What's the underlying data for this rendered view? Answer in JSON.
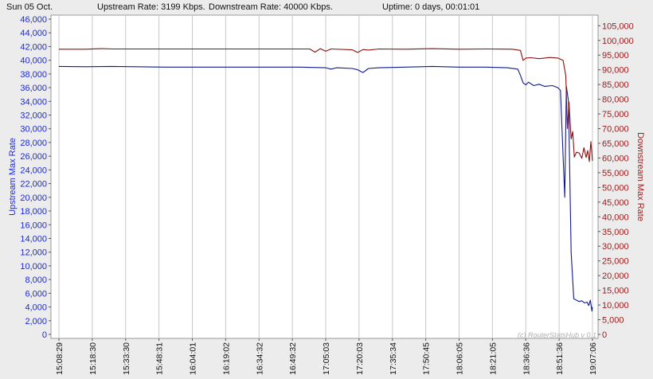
{
  "header": {
    "date": "Sun 05 Oct.",
    "upstream": "Upstream Rate: 3199 Kbps.",
    "downstream": "Downstream Rate: 40000 Kbps.",
    "uptime": "Uptime: 0 days, 00:01:01"
  },
  "chart_data": {
    "type": "line",
    "ylabel": "Upstream Max Rate",
    "y2label": "Downstream Max Rate",
    "watermark": "(c) RouterStatsHub v 0.1",
    "ylim": [
      0,
      46000
    ],
    "y2lim": [
      0,
      107500
    ],
    "yticks": [
      "0",
      "2,000",
      "4,000",
      "6,000",
      "8,000",
      "10,000",
      "12,000",
      "14,000",
      "16,000",
      "18,000",
      "20,000",
      "22,000",
      "24,000",
      "26,000",
      "28,000",
      "30,000",
      "32,000",
      "34,000",
      "36,000",
      "38,000",
      "40,000",
      "42,000",
      "44,000",
      "46,000"
    ],
    "y2ticks": [
      "0",
      "5,000",
      "10,000",
      "15,000",
      "20,000",
      "25,000",
      "30,000",
      "35,000",
      "40,000",
      "45,000",
      "50,000",
      "55,000",
      "60,000",
      "65,000",
      "70,000",
      "75,000",
      "80,000",
      "85,000",
      "90,000",
      "95,000",
      "100,000",
      "105,000"
    ],
    "xticks": [
      "15:08:29",
      "15:18:30",
      "15:33:30",
      "15:48:31",
      "16:04:01",
      "16:19:02",
      "16:34:32",
      "16:49:32",
      "17:05:03",
      "17:20:03",
      "17:35:34",
      "17:50:45",
      "18:06:05",
      "18:21:05",
      "18:36:36",
      "18:51:36",
      "19:07:06"
    ],
    "series": [
      {
        "axis": "left",
        "color": "#0f1a8c",
        "points": [
          [
            0,
            39100
          ],
          [
            0.05,
            39050
          ],
          [
            0.1,
            39100
          ],
          [
            0.2,
            39000
          ],
          [
            0.3,
            39000
          ],
          [
            0.4,
            39000
          ],
          [
            0.45,
            39000
          ],
          [
            0.5,
            38900
          ],
          [
            0.51,
            38700
          ],
          [
            0.52,
            38900
          ],
          [
            0.55,
            38800
          ],
          [
            0.56,
            38600
          ],
          [
            0.57,
            38200
          ],
          [
            0.58,
            38800
          ],
          [
            0.6,
            38900
          ],
          [
            0.65,
            39000
          ],
          [
            0.7,
            39100
          ],
          [
            0.75,
            39000
          ],
          [
            0.8,
            39000
          ],
          [
            0.84,
            38900
          ],
          [
            0.86,
            38700
          ],
          [
            0.865,
            37800
          ],
          [
            0.87,
            36700
          ],
          [
            0.875,
            36400
          ],
          [
            0.88,
            36800
          ],
          [
            0.89,
            36300
          ],
          [
            0.9,
            36500
          ],
          [
            0.91,
            36200
          ],
          [
            0.925,
            36300
          ],
          [
            0.935,
            36000
          ],
          [
            0.94,
            35600
          ],
          [
            0.945,
            26000
          ],
          [
            0.948,
            20000
          ],
          [
            0.951,
            36200
          ],
          [
            0.955,
            34000
          ],
          [
            0.96,
            12000
          ],
          [
            0.965,
            5200
          ],
          [
            0.97,
            5000
          ],
          [
            0.975,
            4800
          ],
          [
            0.98,
            4900
          ],
          [
            0.985,
            4600
          ],
          [
            0.99,
            4700
          ],
          [
            0.993,
            4200
          ],
          [
            0.996,
            5000
          ],
          [
            0.999,
            3400
          ],
          [
            1.0,
            4000
          ]
        ]
      },
      {
        "axis": "right",
        "color": "#8a1010",
        "points": [
          [
            0,
            97000
          ],
          [
            0.05,
            97000
          ],
          [
            0.08,
            97200
          ],
          [
            0.1,
            97100
          ],
          [
            0.2,
            97100
          ],
          [
            0.3,
            97100
          ],
          [
            0.4,
            97100
          ],
          [
            0.47,
            97100
          ],
          [
            0.48,
            96000
          ],
          [
            0.49,
            97200
          ],
          [
            0.5,
            96300
          ],
          [
            0.51,
            97100
          ],
          [
            0.55,
            96800
          ],
          [
            0.56,
            95900
          ],
          [
            0.57,
            96900
          ],
          [
            0.58,
            96700
          ],
          [
            0.6,
            97100
          ],
          [
            0.65,
            97000
          ],
          [
            0.7,
            97200
          ],
          [
            0.75,
            97000
          ],
          [
            0.8,
            97100
          ],
          [
            0.85,
            97000
          ],
          [
            0.865,
            96600
          ],
          [
            0.87,
            93200
          ],
          [
            0.875,
            94000
          ],
          [
            0.885,
            94100
          ],
          [
            0.9,
            93800
          ],
          [
            0.92,
            94200
          ],
          [
            0.935,
            94000
          ],
          [
            0.945,
            93200
          ],
          [
            0.95,
            88000
          ],
          [
            0.953,
            70000
          ],
          [
            0.956,
            79000
          ],
          [
            0.96,
            66500
          ],
          [
            0.963,
            69000
          ],
          [
            0.966,
            60300
          ],
          [
            0.97,
            62000
          ],
          [
            0.975,
            61700
          ],
          [
            0.98,
            59900
          ],
          [
            0.984,
            63500
          ],
          [
            0.988,
            60200
          ],
          [
            0.991,
            62500
          ],
          [
            0.994,
            58800
          ],
          [
            0.997,
            65600
          ],
          [
            1.0,
            59000
          ]
        ]
      }
    ]
  }
}
